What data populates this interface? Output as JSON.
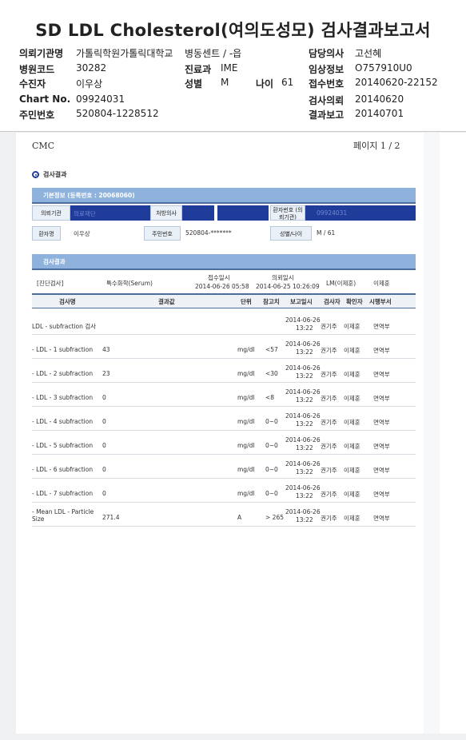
{
  "title": "SD LDL Cholesterol(여의도성모) 검사결과보고서",
  "header": {
    "institution_label": "의뢰기관명",
    "institution_value": "가톨릭학원가톨릭대학교",
    "ward_label": "병동센트 / -읍",
    "doctor_label": "담당의사",
    "doctor_value": "고선혜",
    "hospital_code_label": "병원코드",
    "hospital_code_value": "30282",
    "dept_label": "진료과",
    "dept_value": "IME",
    "clinical_info_label": "임상정보",
    "clinical_info_value": "O757910U0",
    "patient_label": "수진자",
    "patient_value": "이우상",
    "sex_label": "성별",
    "sex_value": "M",
    "age_label": "나이",
    "age_value": "61",
    "receipt_no_label": "접수번호",
    "receipt_no_value": "20140620-22152",
    "chart_label": "Chart No.",
    "chart_value": "09924031",
    "request_date_label": "검사의뢰",
    "request_date_value": "20140620",
    "resident_no_label": "주민번호",
    "resident_no_value": "520804-1228512",
    "report_date_label": "결과보고",
    "report_date_value": "20140701"
  },
  "scan": {
    "cmc": "CMC",
    "page": "페이지 1 / 2",
    "section_title": "검사결과",
    "basic_info_bar": "기본정보 (등록번호 : 20068060)",
    "req_inst_label": "의뢰기관",
    "req_inst_value": "의료재단",
    "prescriber_label": "처방의사",
    "patient_no_label": "환자번호 (의뢰기관)",
    "patient_no_value": "09924031",
    "patient_name_label": "환자명",
    "patient_name_value": "이우상",
    "resident_label": "주민번호",
    "resident_value": "520804-*******",
    "sexage_label": "성별/나이",
    "sexage_value": "M / 61",
    "results_bar": "검사결과",
    "specimen_label": "[진단검사]",
    "specimen_value": "특수화학(Serum)",
    "received_label": "접수일시",
    "received_value": "2014-06-26 05:58",
    "requested_label": "의뢰일시",
    "requested_value": "2014-06-25 10:26:09",
    "reviewer_label": "LM(이제훈)",
    "reviewer_value": "이제훈",
    "columns": [
      "검사명",
      "결과값",
      "단위",
      "참고치",
      "보고일시",
      "검사자",
      "확인자",
      "시행부서"
    ],
    "rows": [
      {
        "name": "LDL - subfraction 검사",
        "value": "",
        "unit": "",
        "ref": "",
        "date": "2014-06-26",
        "time": "13:22",
        "tester": "권기주",
        "checker": "이제훈",
        "dept": "면역부"
      },
      {
        "name": "- LDL - 1 subfraction",
        "value": "43",
        "unit": "mg/dl",
        "ref": "<57",
        "date": "2014-06-26",
        "time": "13:22",
        "tester": "권기주",
        "checker": "이제훈",
        "dept": "면역부"
      },
      {
        "name": "- LDL - 2 subfraction",
        "value": "23",
        "unit": "mg/dl",
        "ref": "<30",
        "date": "2014-06-26",
        "time": "13:22",
        "tester": "권기주",
        "checker": "이제훈",
        "dept": "면역부"
      },
      {
        "name": "- LDL - 3 subfraction",
        "value": "0",
        "unit": "mg/dl",
        "ref": "<8",
        "date": "2014-06-26",
        "time": "13:22",
        "tester": "권기주",
        "checker": "이제훈",
        "dept": "면역부"
      },
      {
        "name": "- LDL - 4 subfraction",
        "value": "0",
        "unit": "mg/dl",
        "ref": "0~0",
        "date": "2014-06-26",
        "time": "13:22",
        "tester": "권기주",
        "checker": "이제훈",
        "dept": "면역부"
      },
      {
        "name": "- LDL - 5 subfraction",
        "value": "0",
        "unit": "mg/dl",
        "ref": "0~0",
        "date": "2014-06-26",
        "time": "13:22",
        "tester": "권기주",
        "checker": "이제훈",
        "dept": "면역부"
      },
      {
        "name": "- LDL - 6 subfraction",
        "value": "0",
        "unit": "mg/dl",
        "ref": "0~0",
        "date": "2014-06-26",
        "time": "13:22",
        "tester": "권기주",
        "checker": "이제훈",
        "dept": "면역부"
      },
      {
        "name": "- LDL - 7 subfraction",
        "value": "0",
        "unit": "mg/dl",
        "ref": "0~0",
        "date": "2014-06-26",
        "time": "13:22",
        "tester": "권기주",
        "checker": "이제훈",
        "dept": "면역부"
      },
      {
        "name": "- Mean LDL - Particle Size",
        "value": "271.4",
        "unit": "A",
        "ref": "> 265",
        "date": "2014-06-26",
        "time": "13:22",
        "tester": "권기주",
        "checker": "이제훈",
        "dept": "면역부"
      }
    ]
  }
}
